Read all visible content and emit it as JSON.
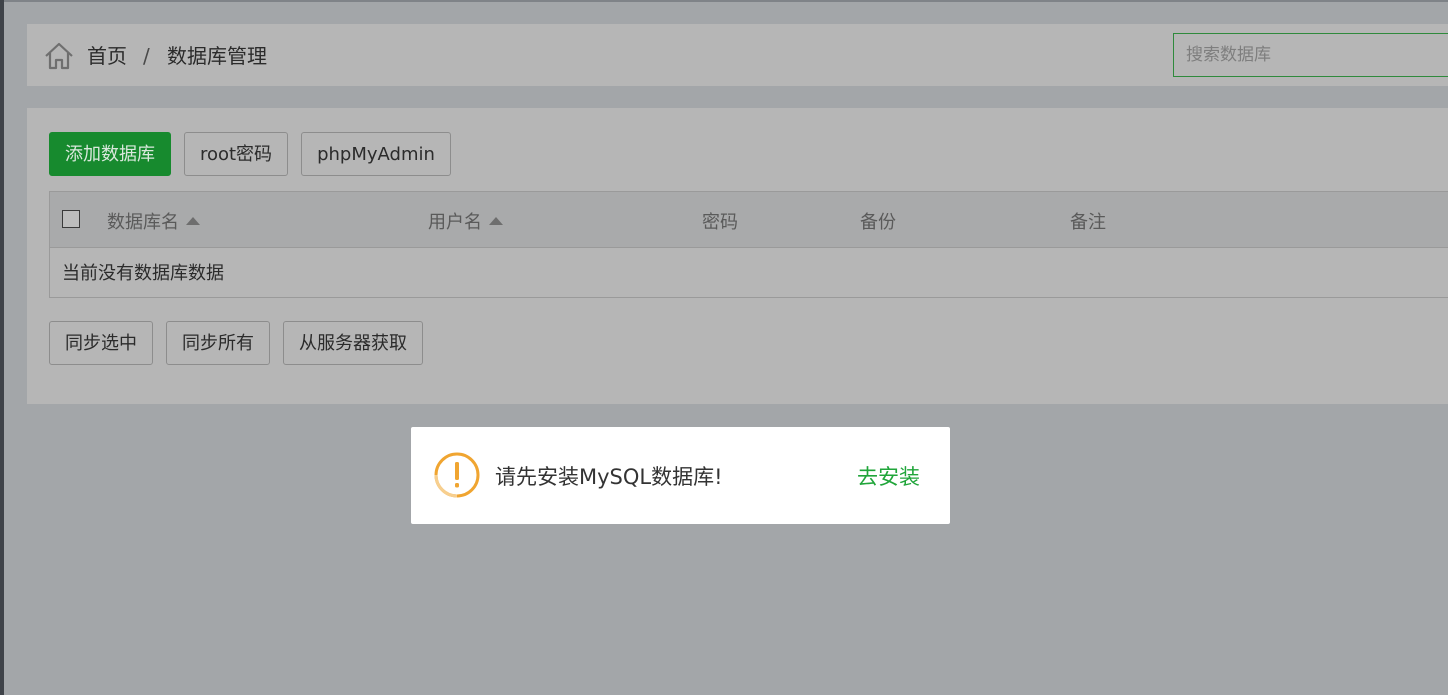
{
  "breadcrumb": {
    "home": "首页",
    "separator": "/",
    "current": "数据库管理"
  },
  "search": {
    "placeholder": "搜索数据库",
    "value": ""
  },
  "toolbar": {
    "add_database": "添加数据库",
    "root_password": "root密码",
    "phpmyadmin": "phpMyAdmin"
  },
  "table": {
    "columns": {
      "name": "数据库名",
      "username": "用户名",
      "password": "密码",
      "backup": "备份",
      "note": "备注"
    },
    "empty_message": "当前没有数据库数据"
  },
  "actions": {
    "sync_selected": "同步选中",
    "sync_all": "同步所有",
    "fetch_from_server": "从服务器获取"
  },
  "dialog": {
    "message": "请先安装MySQL数据库!",
    "install_link": "去安装",
    "icon": "warning-icon"
  },
  "colors": {
    "accent_green": "#20a53a",
    "primary_button": "#178a2e",
    "warning_orange": "#f0a531",
    "overlay": "#a3a6a9"
  }
}
